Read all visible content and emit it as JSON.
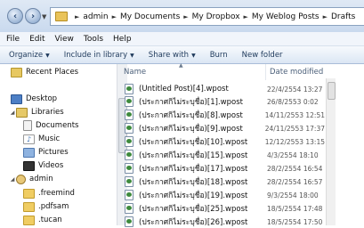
{
  "address": {
    "crumbs": [
      "admin",
      "My Documents",
      "My Dropbox",
      "My Weblog Posts",
      "Drafts"
    ],
    "separator": "►"
  },
  "menu": [
    "File",
    "Edit",
    "View",
    "Tools",
    "Help"
  ],
  "toolbar": {
    "organize": "Organize",
    "include_in_library": "Include in library",
    "share_with": "Share with",
    "burn": "Burn",
    "new_folder": "New folder"
  },
  "nav": {
    "recent_places": "Recent Places",
    "desktop": "Desktop",
    "libraries": "Libraries",
    "documents": "Documents",
    "music": "Music",
    "pictures": "Pictures",
    "videos": "Videos",
    "admin": "admin",
    "freemind": ".freemind",
    "pdfsam": ".pdfsam",
    "tucan": ".tucan"
  },
  "columns": {
    "name": "Name",
    "date_modified": "Date modified"
  },
  "files": [
    {
      "name": "(Untitled Post)[4].wpost",
      "date": "22/4/2554 13:27"
    },
    {
      "name": "(ประกาศกิไม่ระบุชื่อ)[1].wpost",
      "date": "26/8/2553 0:02"
    },
    {
      "name": "(ประกาศกิไม่ระบุชื่อ)[8].wpost",
      "date": "14/11/2553 12:51"
    },
    {
      "name": "(ประกาศกิไม่ระบุชื่อ)[9].wpost",
      "date": "24/11/2553 17:37"
    },
    {
      "name": "(ประกาศกิไม่ระบุชื่อ)[10].wpost",
      "date": "12/12/2553 13:15"
    },
    {
      "name": "(ประกาศกิไม่ระบุชื่อ)[15].wpost",
      "date": "4/3/2554 18:10"
    },
    {
      "name": "(ประกาศกิไม่ระบุชื่อ)[17].wpost",
      "date": "28/2/2554 16:54"
    },
    {
      "name": "(ประกาศกิไม่ระบุชื่อ)[18].wpost",
      "date": "28/2/2554 16:57"
    },
    {
      "name": "(ประกาศกิไม่ระบุชื่อ)[19].wpost",
      "date": "9/3/2554 18:00"
    },
    {
      "name": "(ประกาศกิไม่ระบุชื่อ)[25].wpost",
      "date": "18/5/2554 17:48"
    },
    {
      "name": "(ประกาศกิไม่ระบุชื่อ)[26].wpost",
      "date": "18/5/2554 17:50"
    }
  ]
}
